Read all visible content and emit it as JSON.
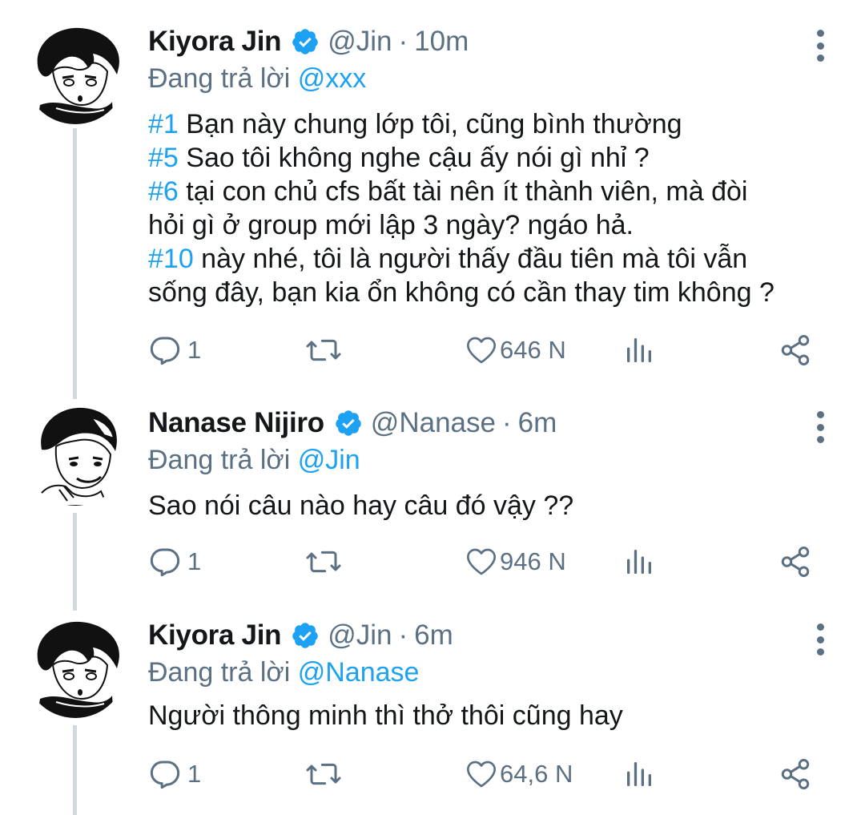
{
  "reply_prefix": "Đang trả lời",
  "tweets": [
    {
      "name": "Kiyora Jin",
      "handle": "@Jin",
      "time": "10m",
      "reply_to": "@xxx",
      "lines": [
        {
          "tag": "#1",
          "text": " Bạn này chung lớp tôi, cũng bình thường"
        },
        {
          "tag": "#5",
          "text": " Sao tôi không nghe cậu ấy nói gì nhỉ ?"
        },
        {
          "tag": "#6",
          "text": " tại con chủ cfs bất tài nên ít thành viên, mà đòi"
        },
        {
          "tag": "",
          "text": "hỏi gì ở group mới lập 3 ngày? ngáo hả."
        },
        {
          "tag": "#10",
          "text": " này nhé, tôi là người thấy đầu tiên mà tôi vẫn"
        },
        {
          "tag": "",
          "text": "sống đây, bạn kia ổn không có cần thay tim không ?"
        }
      ],
      "replies": "1",
      "likes": "646 N"
    },
    {
      "name": "Nanase Nijiro",
      "handle": "@Nanase",
      "time": "6m",
      "reply_to": "@Jin",
      "lines": [
        {
          "tag": "",
          "text": "Sao nói câu nào hay câu đó vậy ??"
        }
      ],
      "replies": "1",
      "likes": "946 N"
    },
    {
      "name": "Kiyora Jin",
      "handle": "@Jin",
      "time": "6m",
      "reply_to": "@Nanase",
      "lines": [
        {
          "tag": "",
          "text": "Người thông minh thì thở thôi cũng hay"
        }
      ],
      "replies": "1",
      "likes": "64,6 N"
    }
  ],
  "separator": "·",
  "icons": {
    "verified": "verified-badge-icon",
    "more": "more-vertical-icon",
    "reply": "reply-bubble-icon",
    "retweet": "retweet-icon",
    "like": "heart-icon",
    "stats": "bar-chart-icon",
    "share": "share-icon"
  },
  "colors": {
    "accent": "#1da1f2",
    "muted": "#5b7083",
    "text": "#14171a",
    "thread_line": "#cfd9de"
  }
}
